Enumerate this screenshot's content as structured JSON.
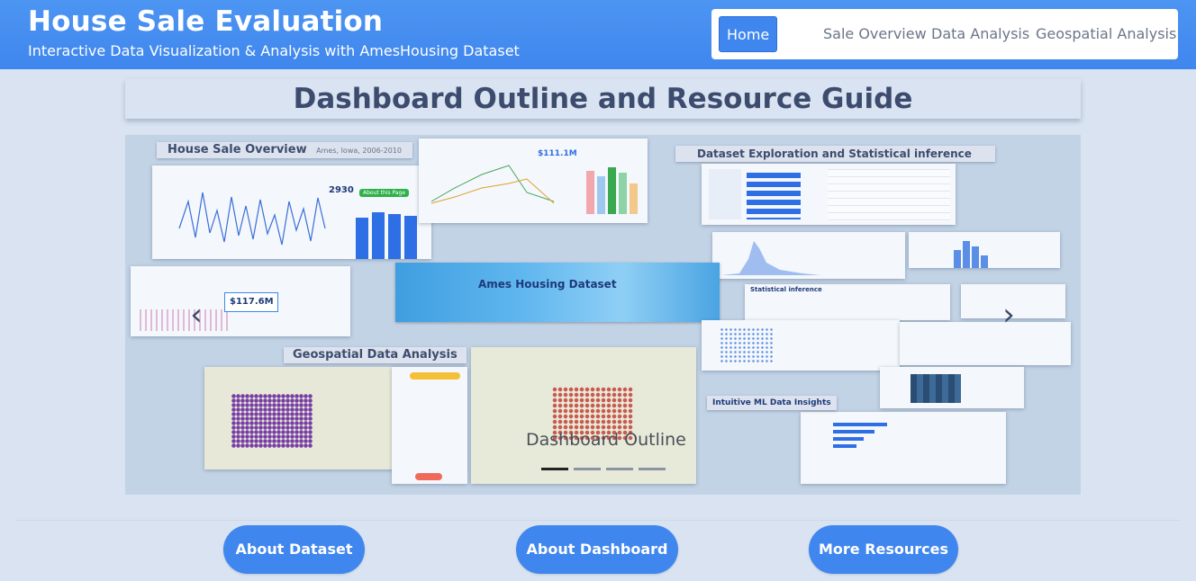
{
  "header": {
    "title": "House Sale Evaluation",
    "subtitle": "Interactive Data Visualization & Analysis with AmesHousing Dataset"
  },
  "nav": {
    "items": [
      "Home",
      "Sale Overview",
      "Data Analysis",
      "Geospatial Analysis"
    ],
    "active": "Home"
  },
  "page": {
    "heading": "Dashboard Outline and Resource Guide"
  },
  "carousel": {
    "caption": "Dashboard Outline",
    "prev_icon": "‹",
    "next_icon": "›",
    "slide_count": 4,
    "active_slide": 0,
    "tiles": {
      "sale_overview_label": "House Sale Overview",
      "sale_overview_sub": "Ames, Iowa, 2006-2010",
      "sale_volume": "2930",
      "gross_sale": "$111.1M",
      "mean_price": "$117.6M",
      "exploration_label": "Dataset Exploration and Statistical inference",
      "hub_title": "Ames Housing Dataset",
      "stat_inference": "Statistical inference",
      "geo_label": "Geospatial Data Analysis",
      "insights_label": "Intuitive ML Data Insights",
      "about_page": "About this Page"
    }
  },
  "buttons": {
    "about_dataset": "About Dataset",
    "about_dashboard": "About Dashboard",
    "more_resources": "More Resources"
  },
  "colors": {
    "header": "#4d95f2",
    "accent": "#3f86ee",
    "background": "#d9e3f1",
    "heading_text": "#3d4c6e"
  }
}
